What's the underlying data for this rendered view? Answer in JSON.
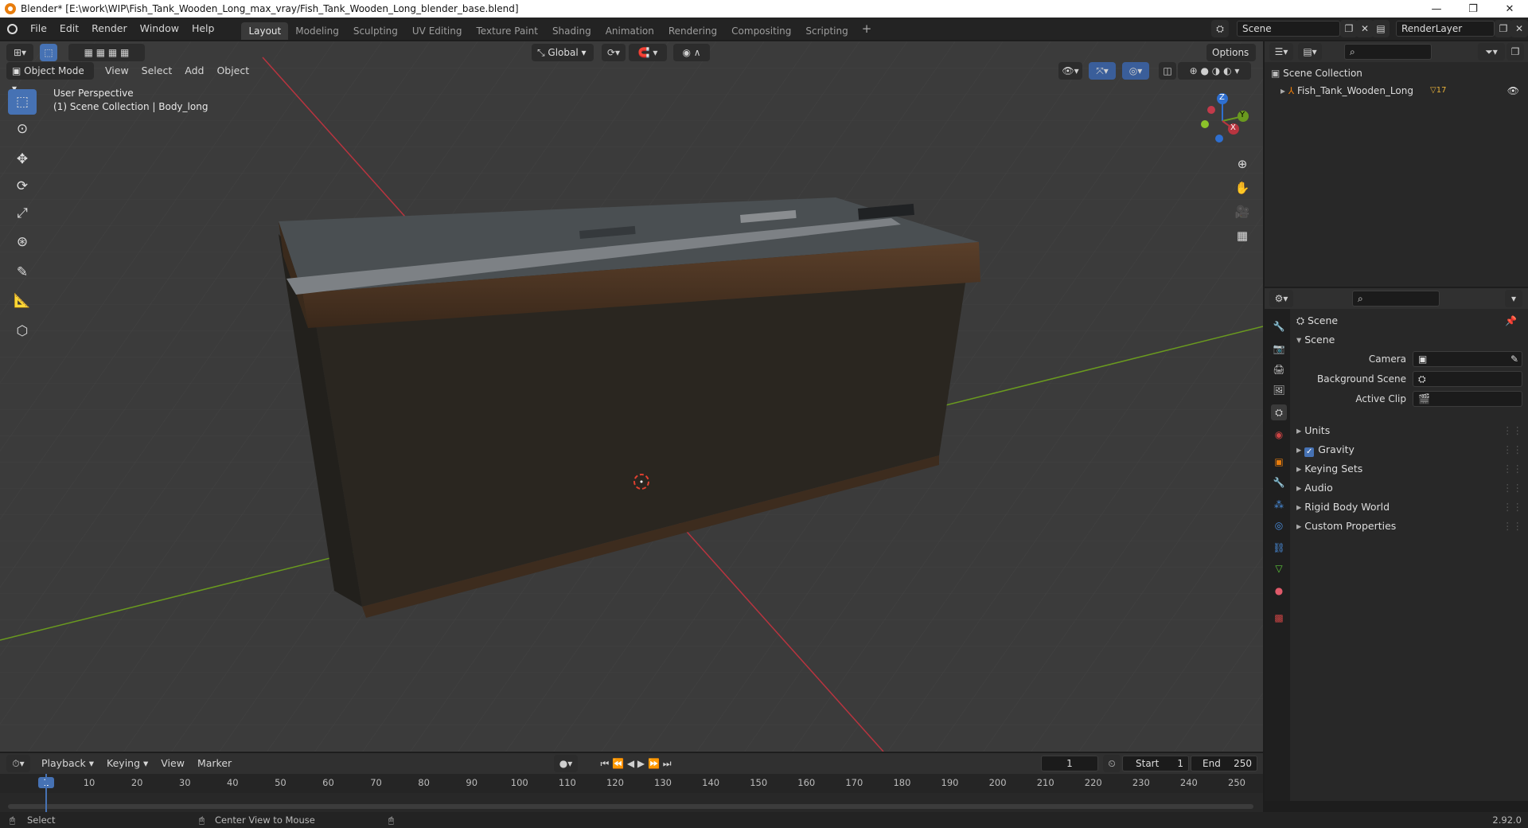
{
  "window": {
    "title": "Blender* [E:\\work\\WIP\\Fish_Tank_Wooden_Long_max_vray/Fish_Tank_Wooden_Long_blender_base.blend]",
    "minimize": "—",
    "maximize": "❐",
    "close": "✕"
  },
  "menu": [
    "File",
    "Edit",
    "Render",
    "Window",
    "Help"
  ],
  "workspaces": [
    "Layout",
    "Modeling",
    "Sculpting",
    "UV Editing",
    "Texture Paint",
    "Shading",
    "Animation",
    "Rendering",
    "Compositing",
    "Scripting"
  ],
  "active_workspace": "Layout",
  "add_workspace": "+",
  "scene_name": "Scene",
  "view_layer": "RenderLayer",
  "viewport": {
    "transform_orientation": "Global",
    "options_label": "Options",
    "mode": "Object Mode",
    "header_menus": [
      "View",
      "Select",
      "Add",
      "Object"
    ],
    "overlay_title": "User Perspective",
    "overlay_subtitle": "(1) Scene Collection | Body_long",
    "gizmo": {
      "z": "Z",
      "y": "Y",
      "x": "X"
    }
  },
  "outliner": {
    "root": "Scene Collection",
    "items": [
      {
        "label": "Fish_Tank_Wooden_Long",
        "badge": "17"
      }
    ]
  },
  "properties": {
    "header": "Scene",
    "section": "Scene",
    "fields": [
      {
        "label": "Camera",
        "value": ""
      },
      {
        "label": "Background Scene",
        "value": ""
      },
      {
        "label": "Active Clip",
        "value": ""
      }
    ],
    "panels": [
      "Units",
      "Gravity",
      "Keying Sets",
      "Audio",
      "Rigid Body World",
      "Custom Properties"
    ],
    "gravity_checked": true
  },
  "timeline": {
    "menus": [
      "Playback",
      "Keying",
      "View",
      "Marker"
    ],
    "current_frame": "1",
    "start_label": "Start",
    "start": "1",
    "end_label": "End",
    "end": "250",
    "ticks": [
      "1",
      "10",
      "20",
      "30",
      "40",
      "50",
      "60",
      "70",
      "80",
      "90",
      "100",
      "110",
      "120",
      "130",
      "140",
      "150",
      "160",
      "170",
      "180",
      "190",
      "200",
      "210",
      "220",
      "230",
      "240",
      "250"
    ]
  },
  "status": {
    "left": "Select",
    "middle": "Center View to Mouse",
    "version": "2.92.0"
  },
  "colors": {
    "accent": "#4672b4",
    "viewport_bg": "#3b3b3b",
    "panel_bg": "#282828",
    "x_axis": "#b8343f",
    "y_axis": "#6a9a1f",
    "z_axis": "#2e6fd0"
  }
}
